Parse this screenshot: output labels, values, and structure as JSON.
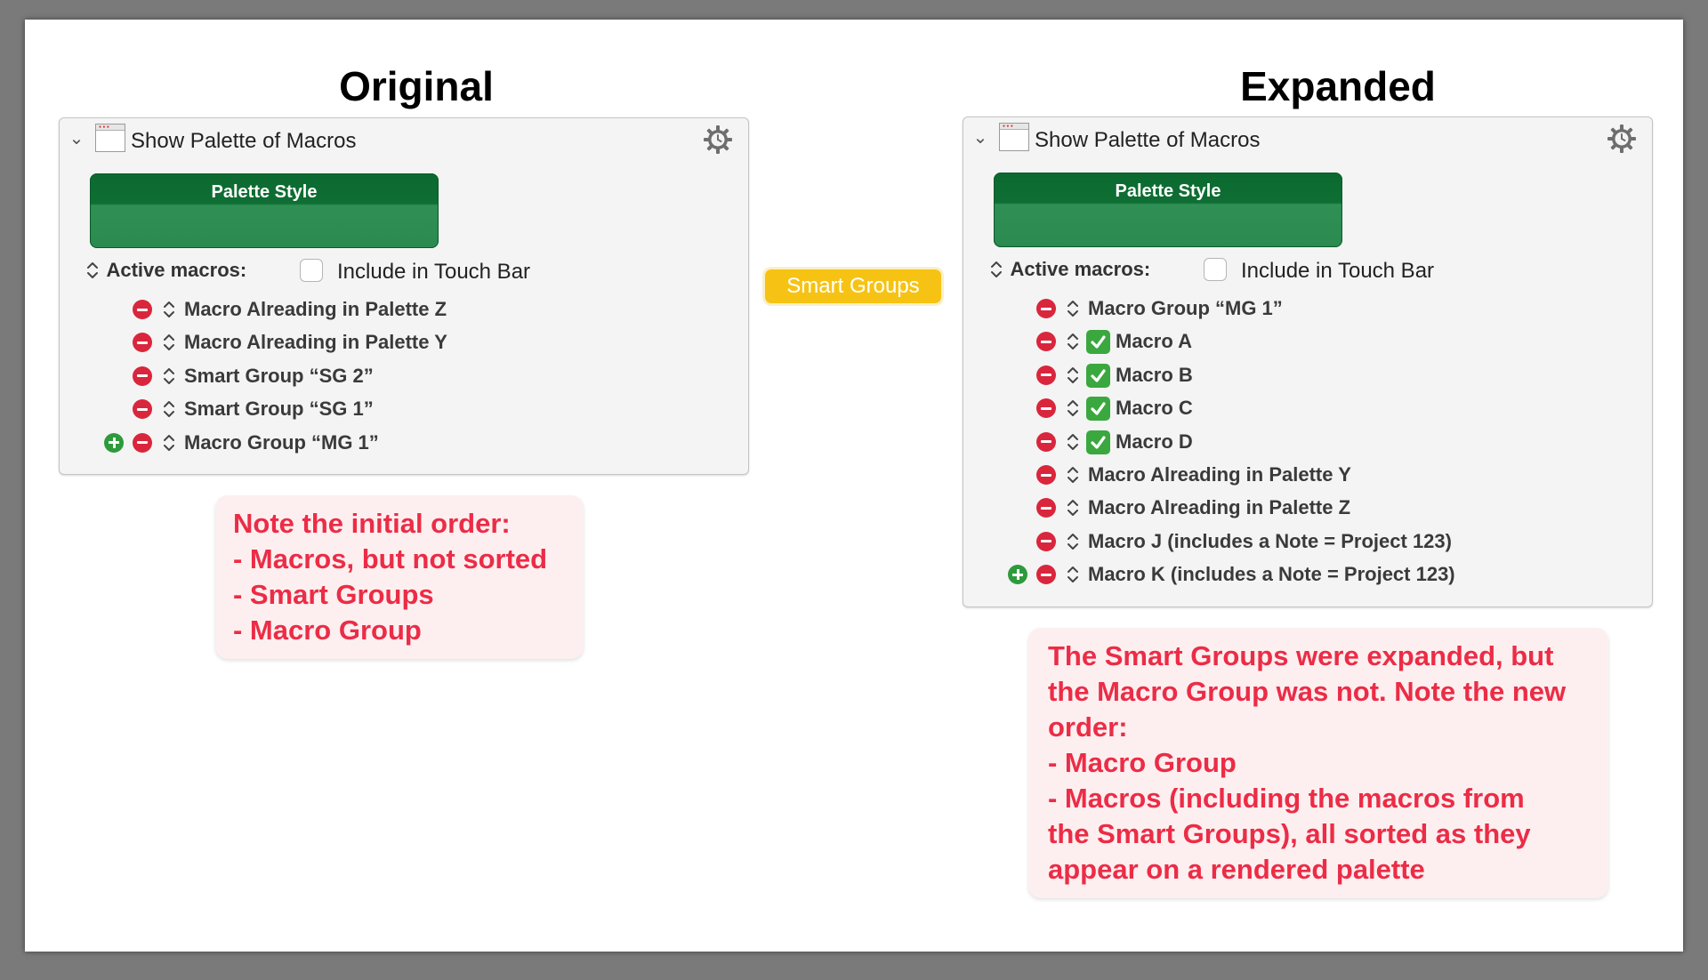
{
  "left": {
    "title": "Original",
    "action_title": "Show Palette of Macros",
    "palette_style_label": "Palette Style",
    "active_macros_label": "Active macros:",
    "touch_bar_label": "Include in Touch Bar",
    "items": [
      {
        "label": "Macro Alreading in Palette Z",
        "checked": false
      },
      {
        "label": "Macro Alreading in Palette Y",
        "checked": false
      },
      {
        "label": "Smart Group “SG 2”",
        "checked": false
      },
      {
        "label": "Smart Group “SG 1”",
        "checked": false
      },
      {
        "label": "Macro Group “MG 1”",
        "checked": false
      }
    ]
  },
  "center": {
    "smart_groups_button": "Smart Groups"
  },
  "right": {
    "title": "Expanded",
    "action_title": "Show Palette of Macros",
    "palette_style_label": "Palette Style",
    "active_macros_label": "Active macros:",
    "touch_bar_label": "Include in Touch Bar",
    "items": [
      {
        "label": "Macro Group “MG 1”",
        "checked": false
      },
      {
        "label": "Macro A",
        "checked": true
      },
      {
        "label": "Macro B",
        "checked": true
      },
      {
        "label": "Macro C",
        "checked": true
      },
      {
        "label": "Macro D",
        "checked": true
      },
      {
        "label": "Macro Alreading in Palette Y",
        "checked": false
      },
      {
        "label": "Macro Alreading in Palette Z",
        "checked": false
      },
      {
        "label": "Macro J (includes a Note = Project 123)",
        "checked": false
      },
      {
        "label": "Macro K (includes a Note = Project 123)",
        "checked": false
      }
    ]
  },
  "notes": {
    "left": [
      "Note the initial order:",
      "- Macros, but not sorted",
      "- Smart Groups",
      "- Macro Group"
    ],
    "right": [
      "The Smart Groups were expanded, but",
      "the Macro Group was not. Note the new",
      "order:",
      "- Macro Group",
      "- Macros (including the macros from",
      "the Smart Groups), all sorted as they",
      "appear on a rendered palette"
    ]
  },
  "colors": {
    "minus": "#d9263c",
    "plus": "#2e9a3c",
    "palette_green": "#0e6e33",
    "smart_groups_yellow": "#f6c315",
    "note_text": "#ec2c46",
    "note_bg": "#fdeff0"
  }
}
